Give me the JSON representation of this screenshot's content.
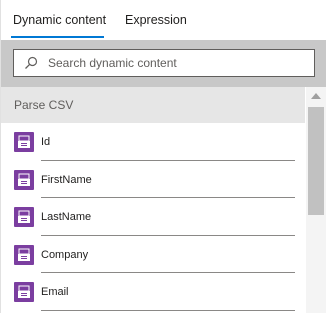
{
  "tabs": [
    {
      "label": "Dynamic content",
      "active": true
    },
    {
      "label": "Expression",
      "active": false
    }
  ],
  "search": {
    "placeholder": "Search dynamic content",
    "value": "",
    "icon": "search-icon"
  },
  "section": {
    "title": "Parse CSV"
  },
  "items": [
    {
      "label": "Id",
      "icon": "data-operation-icon"
    },
    {
      "label": "FirstName",
      "icon": "data-operation-icon"
    },
    {
      "label": "LastName",
      "icon": "data-operation-icon"
    },
    {
      "label": "Company",
      "icon": "data-operation-icon"
    },
    {
      "label": "Email",
      "icon": "data-operation-icon"
    }
  ],
  "colors": {
    "accent": "#0078d4",
    "item_icon_bg": "#7b3ea0",
    "search_band": "#c8c8c8",
    "section_bg": "#e6e6e6"
  }
}
